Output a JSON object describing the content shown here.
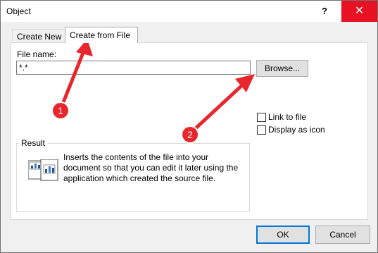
{
  "window": {
    "title": "Object",
    "help_label": "?",
    "close_label": "✕"
  },
  "tabs": [
    {
      "label": "Create New"
    },
    {
      "label": "Create from File"
    }
  ],
  "form": {
    "filename_label": "File name:",
    "filename_value": "*.*",
    "browse_label": "Browse...",
    "link_label": "Link to file",
    "display_icon_label": "Display as icon"
  },
  "result": {
    "label": "Result",
    "text": "Inserts the contents of the file into your document so that you can edit it later using the application which created the source file."
  },
  "buttons": {
    "ok_label": "OK",
    "cancel_label": "Cancel"
  },
  "annotations": {
    "callout_1": "1",
    "callout_2": "2",
    "arrow_color": "#e8262d"
  }
}
